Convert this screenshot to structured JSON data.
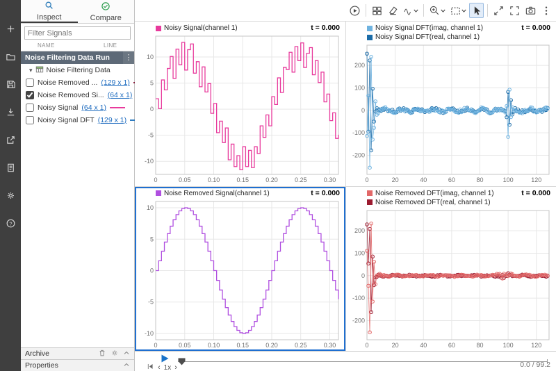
{
  "left_toolbar": {
    "icons": [
      "add",
      "open",
      "save",
      "import",
      "export",
      "create-report",
      "preferences",
      "help"
    ]
  },
  "sidebar": {
    "tabs": [
      {
        "label": "Inspect",
        "icon": "magnifier",
        "selected": true
      },
      {
        "label": "Compare",
        "icon": "check-circle",
        "selected": false
      }
    ],
    "filter_placeholder": "Filter Signals",
    "columns": [
      "NAME",
      "LINE"
    ],
    "run": {
      "label": "Noise Filtering Data Run"
    },
    "group": {
      "label": "Noise Filtering Data"
    },
    "signals": [
      {
        "name": "Noise Removed ...",
        "dims": "(129 x 1)",
        "checked": false,
        "color": "#8a1f3d"
      },
      {
        "name": "Noise Removed Si...",
        "dims": "(64 x 1)",
        "checked": true,
        "color": "#b04fe0"
      },
      {
        "name": "Noisy Signal",
        "dims": "(64 x 1)",
        "checked": false,
        "color": "#e83a9c"
      },
      {
        "name": "Noisy Signal DFT",
        "dims": "(129 x 1)",
        "checked": false,
        "color": "#2f7cc0"
      }
    ],
    "archive_label": "Archive",
    "properties_label": "Properties"
  },
  "toolbar": {
    "icons": [
      "run",
      "layout",
      "clear",
      "signals",
      "zoom",
      "fit-to-view",
      "pointer",
      "pan",
      "fullscreen",
      "snapshot",
      "more"
    ],
    "active": "pointer"
  },
  "transport": {
    "speed": "1x",
    "time": "0.0 / 99.2"
  },
  "chart_data": [
    {
      "id": "noisy-signal",
      "type": "stair",
      "legend": [
        {
          "label": "Noisy Signal(channel 1)",
          "color": "#e83a9c"
        }
      ],
      "t_label": "t = 0.000",
      "x_start": 0,
      "x_step": 0.005,
      "xlim": [
        0,
        0.315
      ],
      "ylim": [
        -12.5,
        14
      ],
      "xticks": [
        0,
        0.05,
        0.1,
        0.15,
        0.2,
        0.25,
        0.3
      ],
      "xtick_labels": [
        "0",
        "0.05",
        "0.10",
        "0.15",
        "0.20",
        "0.25",
        "0.30"
      ],
      "yticks": [
        -10,
        -5,
        0,
        5,
        10
      ],
      "values": [
        2,
        0.1,
        5.6,
        3.7,
        7.8,
        10.1,
        5.9,
        11.5,
        8.5,
        12.8,
        7.5,
        11.4,
        12.5,
        6.9,
        9.1,
        4.3,
        8.1,
        3.3,
        4.9,
        -0.8,
        1.1,
        -4.5,
        -2.3,
        -6.4,
        -3.6,
        -9.7,
        -6.7,
        -11,
        -8.9,
        -11.6,
        -7.2,
        -11,
        -7.9,
        -11.2,
        -7.2,
        -8.5,
        -3.2,
        -5.4,
        -1.1,
        -3.2,
        2.4,
        0.9,
        6,
        3.2,
        8,
        7.6,
        10.9,
        7.1,
        12,
        9.3,
        12.7,
        8,
        10.7,
        11.8,
        6.6,
        9.3,
        5.1,
        7.1,
        1.4,
        2.9,
        -2.2,
        -0.7,
        -5.6,
        -4.9
      ]
    },
    {
      "id": "noisy-dft",
      "type": "scatter",
      "legend": [
        {
          "label": "Noisy Signal DFT(imag, channel 1)",
          "color": "#6fb3e0"
        },
        {
          "label": "Noisy Signal DFT(real, channel 1)",
          "color": "#1b6ca8"
        }
      ],
      "t_label": "t = 0.000",
      "xlim": [
        0,
        129
      ],
      "ylim": [
        -285,
        290
      ],
      "xticks": [
        0,
        20,
        40,
        60,
        80,
        100,
        120
      ],
      "yticks": [
        -200,
        -100,
        0,
        100,
        200
      ],
      "series": [
        {
          "name": "real",
          "color": "#1b6ca8",
          "gen": {
            "n": 129,
            "seed": 13,
            "noise": 7,
            "env0": 160,
            "ripple": 5,
            "hf": {
              "center": 101,
              "width": 2.2,
              "amp": 60
            },
            "spikes": [
              [
                0,
                252
              ],
              [
                2,
                222
              ],
              [
                3,
                -178
              ],
              [
                4,
                96
              ],
              [
                5,
                -50
              ],
              [
                100,
                82
              ],
              [
                101,
                -64
              ]
            ]
          }
        },
        {
          "name": "imag",
          "color": "#6fb3e0",
          "gen": {
            "n": 129,
            "seed": 7,
            "noise": 8,
            "env0": 175,
            "ripple": 6,
            "hf": {
              "center": 101,
              "width": 2.5,
              "amp": 85
            },
            "spikes": [
              [
                1,
                65
              ],
              [
                2,
                -255
              ],
              [
                3,
                238
              ],
              [
                4,
                -130
              ],
              [
                5,
                -78
              ],
              [
                6,
                40
              ],
              [
                100,
                -118
              ],
              [
                101,
                92
              ]
            ]
          }
        }
      ]
    },
    {
      "id": "noise-removed-signal",
      "type": "stair",
      "selected": true,
      "legend": [
        {
          "label": "Noise Removed Signal(channel 1)",
          "color": "#b04fe0"
        }
      ],
      "t_label": "t = 0.000",
      "x_start": 0,
      "x_step": 0.005,
      "xlim": [
        0,
        0.315
      ],
      "ylim": [
        -11,
        11
      ],
      "xticks": [
        0,
        0.05,
        0.1,
        0.15,
        0.2,
        0.25,
        0.3
      ],
      "xtick_labels": [
        "0",
        "0.05",
        "0.10",
        "0.15",
        "0.20",
        "0.25",
        "0.30"
      ],
      "yticks": [
        -10,
        -5,
        0,
        5,
        10
      ],
      "values": [
        0,
        1.56,
        3.09,
        4.54,
        5.88,
        7.07,
        8.09,
        8.91,
        9.51,
        9.88,
        10,
        9.88,
        9.51,
        8.91,
        8.09,
        7.07,
        5.88,
        4.54,
        3.09,
        1.56,
        0,
        -1.56,
        -3.09,
        -4.54,
        -5.88,
        -7.07,
        -8.09,
        -8.91,
        -9.51,
        -9.88,
        -10,
        -9.88,
        -9.51,
        -8.91,
        -8.09,
        -7.07,
        -5.88,
        -4.54,
        -3.09,
        -1.56,
        0,
        1.56,
        3.09,
        4.54,
        5.88,
        7.07,
        8.09,
        8.91,
        9.51,
        9.88,
        10,
        9.88,
        9.51,
        8.91,
        8.09,
        7.07,
        5.88,
        4.54,
        3.09,
        1.56,
        0,
        -1.56,
        -3.09,
        -4.54
      ]
    },
    {
      "id": "noise-removed-dft",
      "type": "scatter",
      "legend": [
        {
          "label": "Noise Removed DFT(imag, channel 1)",
          "color": "#e26868"
        },
        {
          "label": "Noise Removed DFT(real, channel 1)",
          "color": "#9c1b30"
        }
      ],
      "t_label": "t = 0.000",
      "xlim": [
        0,
        129
      ],
      "ylim": [
        -285,
        290
      ],
      "xticks": [
        0,
        20,
        40,
        60,
        80,
        100,
        120
      ],
      "yticks": [
        -200,
        -100,
        0,
        100,
        200
      ],
      "series": [
        {
          "name": "real",
          "color": "#9c1b30",
          "gen": {
            "n": 129,
            "seed": 29,
            "noise": 2.5,
            "env0": 165,
            "ripple": 2.5,
            "hf": {
              "center": 97,
              "width": 5,
              "amp": 12
            },
            "spikes": [
              [
                0,
                228
              ],
              [
                2,
                208
              ],
              [
                3,
                -162
              ],
              [
                4,
                85
              ],
              [
                5,
                -42
              ]
            ]
          }
        },
        {
          "name": "imag",
          "color": "#e26868",
          "gen": {
            "n": 129,
            "seed": 21,
            "noise": 2.5,
            "env0": 185,
            "ripple": 3,
            "hf": {
              "center": 97,
              "width": 5,
              "amp": 14
            },
            "spikes": [
              [
                1,
                -45
              ],
              [
                2,
                -252
              ],
              [
                3,
                232
              ],
              [
                4,
                -115
              ],
              [
                5,
                62
              ],
              [
                6,
                -38
              ]
            ]
          }
        }
      ]
    }
  ]
}
